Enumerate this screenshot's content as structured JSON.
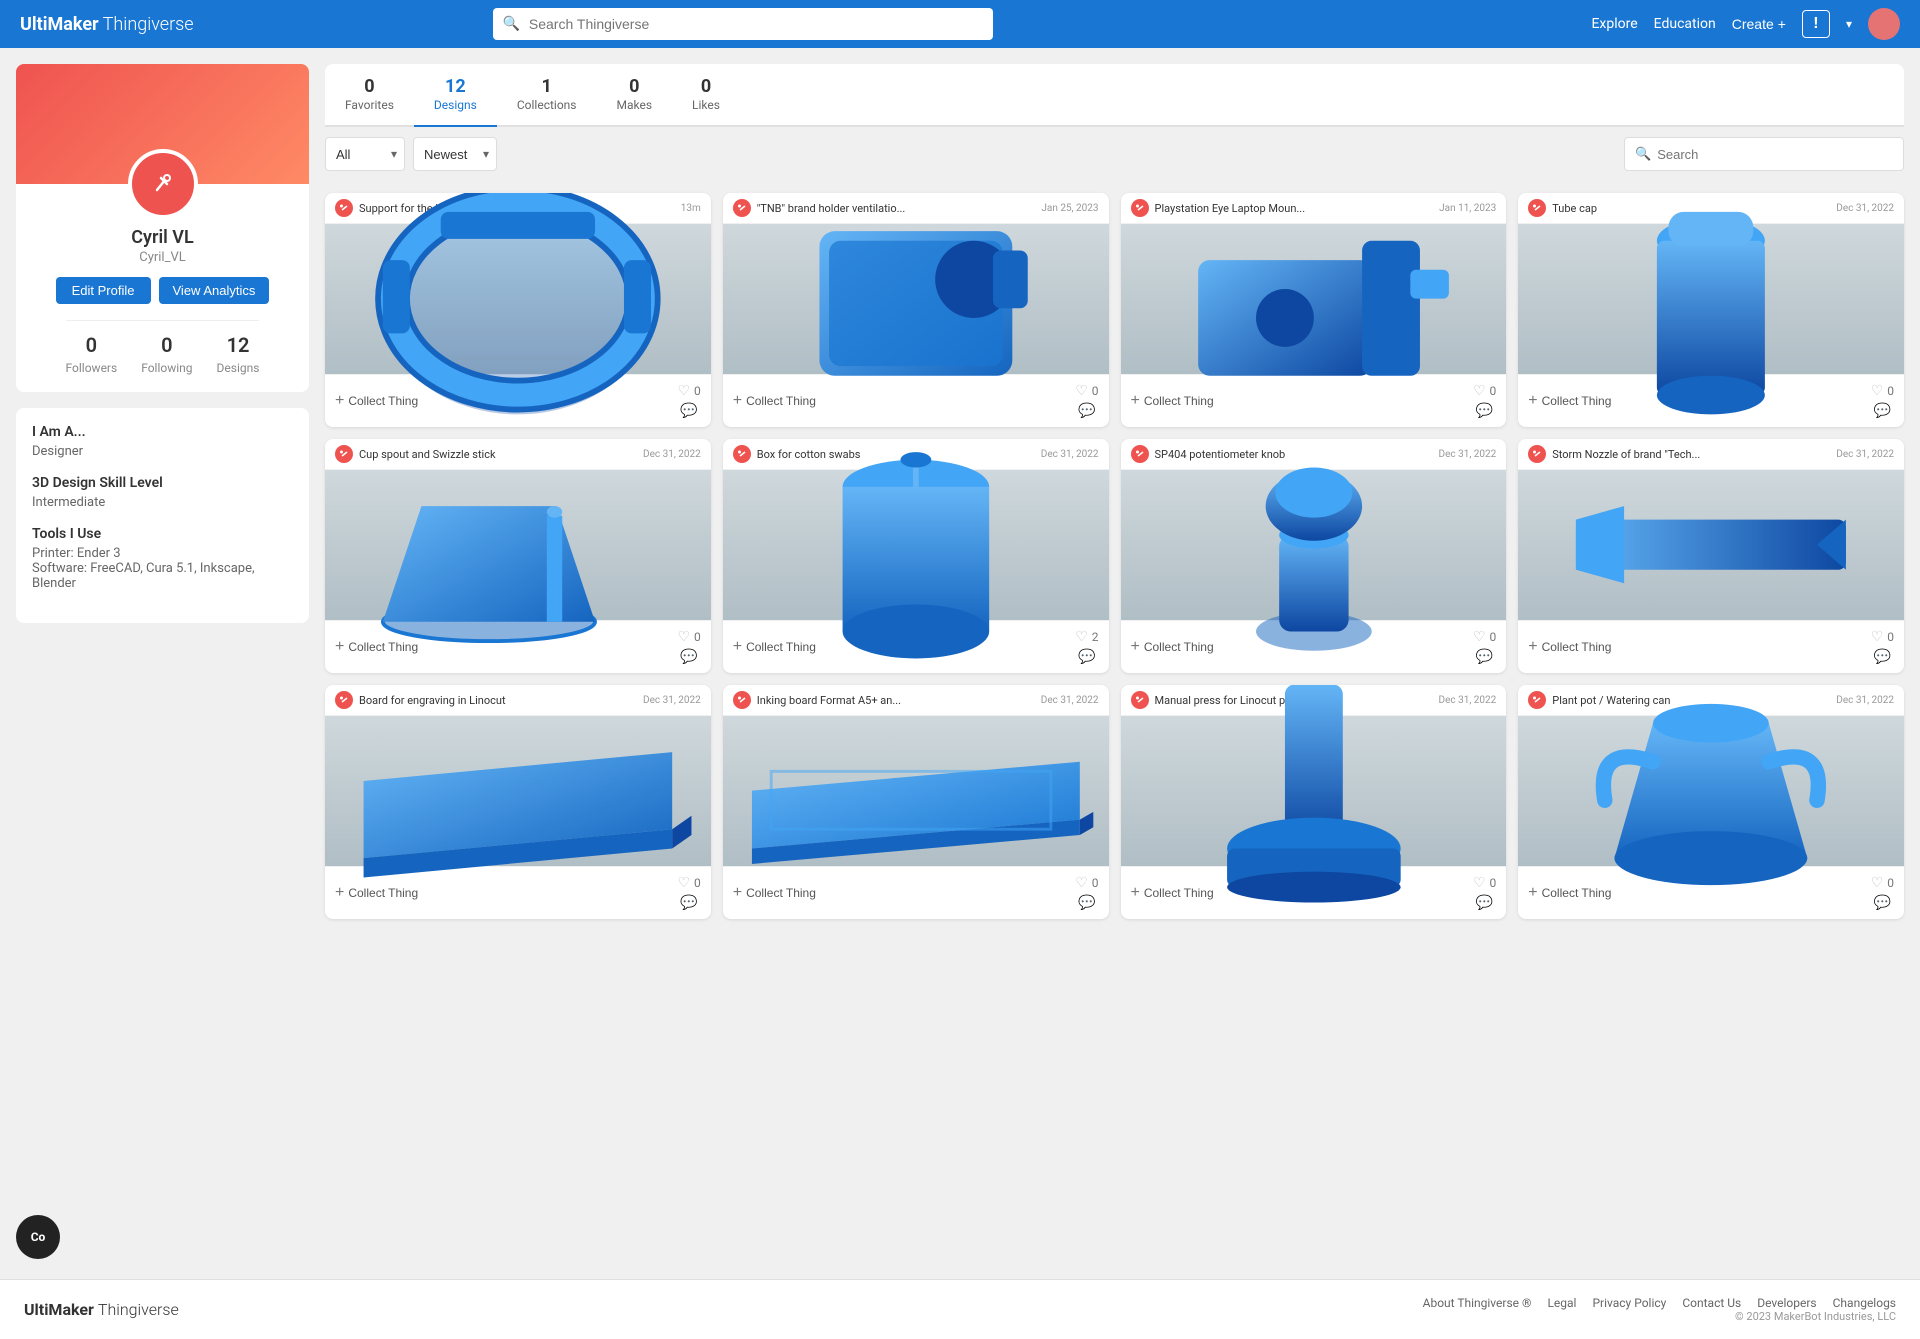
{
  "header": {
    "logo_bold": "UltiMaker",
    "logo_light": "Thingiverse",
    "search_placeholder": "Search Thingiverse",
    "nav": {
      "explore": "Explore",
      "education": "Education",
      "create": "Create",
      "create_icon": "+"
    }
  },
  "profile": {
    "name": "Cyril VL",
    "username": "Cyril_VL",
    "edit_label": "Edit Profile",
    "analytics_label": "View Analytics",
    "followers": {
      "count": "0",
      "label": "Followers"
    },
    "following": {
      "count": "0",
      "label": "Following"
    },
    "designs": {
      "count": "12",
      "label": "Designs"
    },
    "i_am": {
      "title": "I Am A...",
      "value": "Designer"
    },
    "skill": {
      "title": "3D Design Skill Level",
      "value": "Intermediate"
    },
    "tools": {
      "title": "Tools I Use",
      "printer": "Printer: Ender 3",
      "software": "Software: FreeCAD, Cura 5.1, Inkscape, Blender"
    }
  },
  "tabs": [
    {
      "id": "favorites",
      "count": "0",
      "label": "Favorites"
    },
    {
      "id": "designs",
      "count": "12",
      "label": "Designs",
      "active": true
    },
    {
      "id": "collections",
      "count": "1",
      "label": "Collections"
    },
    {
      "id": "makes",
      "count": "0",
      "label": "Makes"
    },
    {
      "id": "likes",
      "count": "0",
      "label": "Likes"
    }
  ],
  "filters": {
    "all_label": "All",
    "newest_label": "Newest",
    "search_placeholder": "Search"
  },
  "things": [
    {
      "id": 1,
      "title": "Support for the bike counter 'Bryton ...",
      "date": "13m",
      "likes": "0",
      "collect_label": "Collect Thing",
      "shape": "ring"
    },
    {
      "id": 2,
      "title": "\"TNB\" brand holder ventilatio...",
      "date": "Jan 25, 2023",
      "likes": "0",
      "collect_label": "Collect Thing",
      "shape": "holder"
    },
    {
      "id": 3,
      "title": "Playstation Eye Laptop Moun...",
      "date": "Jan 11, 2023",
      "likes": "0",
      "collect_label": "Collect Thing",
      "shape": "mount"
    },
    {
      "id": 4,
      "title": "Tube cap",
      "date": "Dec 31, 2022",
      "likes": "0",
      "collect_label": "Collect Thing",
      "shape": "tube"
    },
    {
      "id": 5,
      "title": "Cup spout and Swizzle stick",
      "date": "Dec 31, 2022",
      "likes": "0",
      "collect_label": "Collect Thing",
      "shape": "spout"
    },
    {
      "id": 6,
      "title": "Box for cotton swabs",
      "date": "Dec 31, 2022",
      "likes": "2",
      "collect_label": "Collect Thing",
      "shape": "box"
    },
    {
      "id": 7,
      "title": "SP404 potentiometer knob",
      "date": "Dec 31, 2022",
      "likes": "0",
      "collect_label": "Collect Thing",
      "shape": "knob"
    },
    {
      "id": 8,
      "title": "Storm Nozzle of brand \"Tech...",
      "date": "Dec 31, 2022",
      "likes": "0",
      "collect_label": "Collect Thing",
      "shape": "nozzle"
    },
    {
      "id": 9,
      "title": "Board for engraving in Linocut",
      "date": "Dec 31, 2022",
      "likes": "0",
      "collect_label": "Collect Thing",
      "shape": "board"
    },
    {
      "id": 10,
      "title": "Inking board Format A5+ an...",
      "date": "Dec 31, 2022",
      "likes": "0",
      "collect_label": "Collect Thing",
      "shape": "flat-board"
    },
    {
      "id": 11,
      "title": "Manual press for Linocut print",
      "date": "Dec 31, 2022",
      "likes": "0",
      "collect_label": "Collect Thing",
      "shape": "press"
    },
    {
      "id": 12,
      "title": "Plant pot / Watering can",
      "date": "Dec 31, 2022",
      "likes": "0",
      "collect_label": "Collect Thing",
      "shape": "pot"
    }
  ],
  "footer": {
    "logo_bold": "UltiMaker",
    "logo_light": "Thingiverse",
    "links": [
      "About Thingiverse ®",
      "Legal",
      "Privacy Policy",
      "Contact Us",
      "Developers",
      "Changelogs"
    ],
    "copyright": "© 2023 MakerBot Industries, LLC"
  },
  "cookie": {
    "label": "Co"
  }
}
